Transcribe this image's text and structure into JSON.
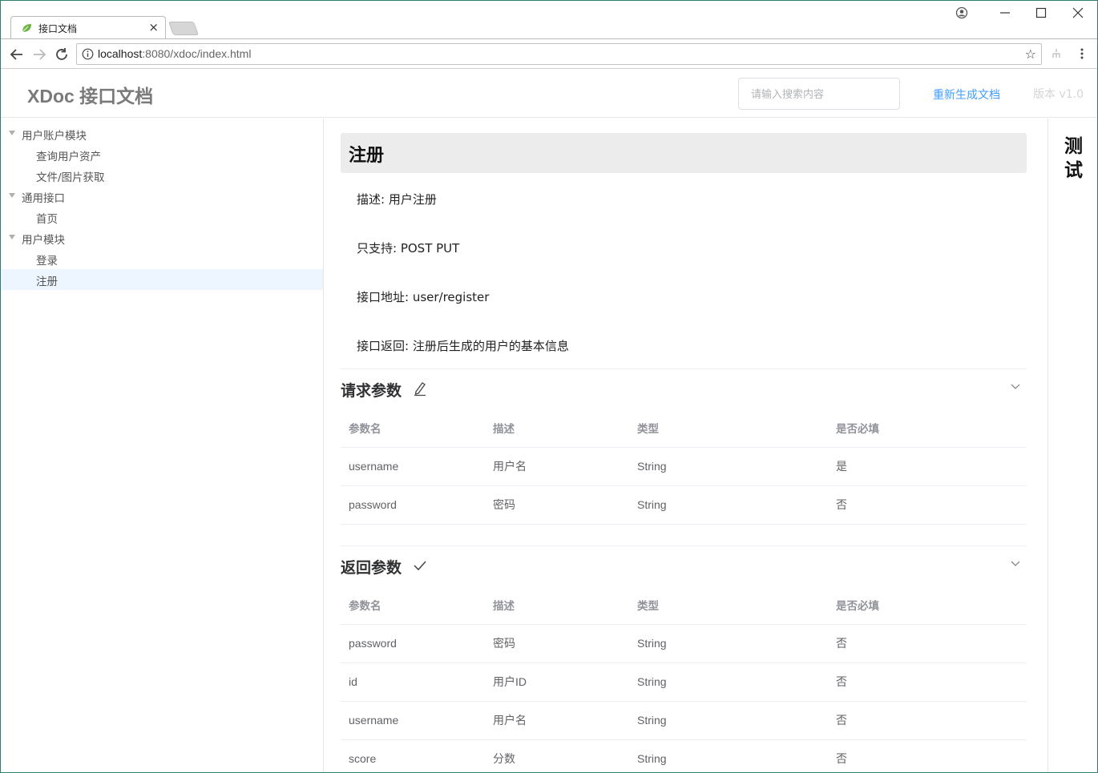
{
  "browser": {
    "tab_title": "接口文档",
    "url_host": "localhost",
    "url_rest": ":8080/xdoc/index.html"
  },
  "header": {
    "brand": "XDoc 接口文档",
    "search_placeholder": "请输入搜索内容",
    "regenerate_label": "重新生成文档",
    "version_label": "版本 v1.0"
  },
  "sidebar": {
    "items": [
      {
        "label": "用户账户模块",
        "level": 0,
        "expanded": true,
        "active": false
      },
      {
        "label": "查询用户资产",
        "level": 1,
        "active": false
      },
      {
        "label": "文件/图片获取",
        "level": 1,
        "active": false
      },
      {
        "label": "通用接口",
        "level": 0,
        "expanded": true,
        "active": false
      },
      {
        "label": "首页",
        "level": 1,
        "active": false
      },
      {
        "label": "用户模块",
        "level": 0,
        "expanded": true,
        "active": false
      },
      {
        "label": "登录",
        "level": 1,
        "active": false
      },
      {
        "label": "注册",
        "level": 1,
        "active": true
      }
    ]
  },
  "main": {
    "title": "注册",
    "description": "描述: 用户注册",
    "methods": "只支持: POST PUT",
    "path": "接口地址: user/register",
    "returns": "接口返回: 注册后生成的用户的基本信息",
    "request_section": {
      "title": "请求参数",
      "icon": "edit-icon",
      "headers": [
        "参数名",
        "描述",
        "类型",
        "是否必填"
      ],
      "rows": [
        [
          "username",
          "用户名",
          "String",
          "是"
        ],
        [
          "password",
          "密码",
          "String",
          "否"
        ]
      ]
    },
    "response_section": {
      "title": "返回参数",
      "icon": "check-icon",
      "headers": [
        "参数名",
        "描述",
        "类型",
        "是否必填"
      ],
      "rows": [
        [
          "password",
          "密码",
          "String",
          "否"
        ],
        [
          "id",
          "用户ID",
          "String",
          "否"
        ],
        [
          "username",
          "用户名",
          "String",
          "否"
        ],
        [
          "score",
          "分数",
          "String",
          "否"
        ]
      ]
    }
  },
  "test_panel": {
    "label": "测试"
  },
  "colors": {
    "accent": "#409eff",
    "active_bg": "#edf5ff",
    "title_bg": "#ececec"
  }
}
